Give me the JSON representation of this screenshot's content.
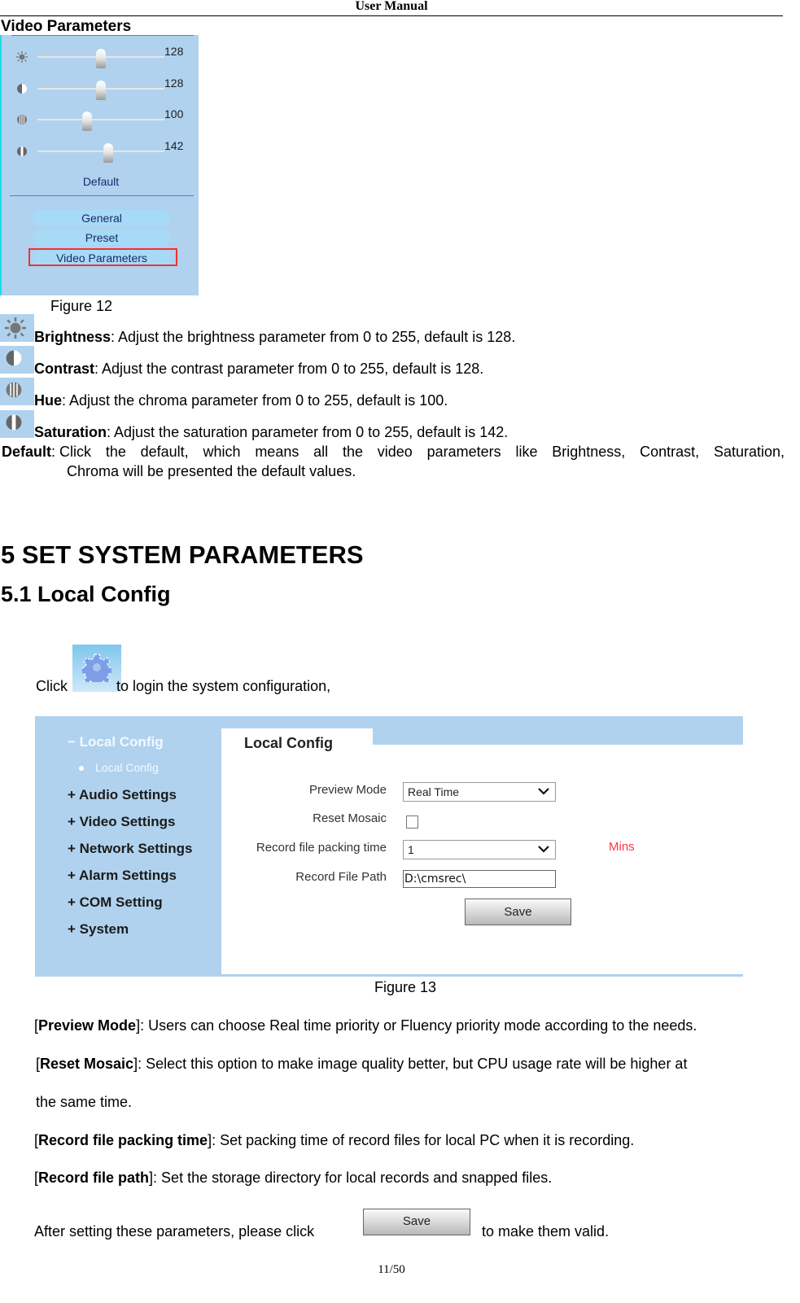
{
  "header": {
    "title": "User Manual"
  },
  "video_parameters": {
    "heading": "Video Parameters",
    "figure": {
      "sliders": [
        {
          "name": "brightness",
          "icon": "brightness-icon",
          "value": "128",
          "fraction": 0.5
        },
        {
          "name": "contrast",
          "icon": "contrast-icon",
          "value": "128",
          "fraction": 0.5
        },
        {
          "name": "hue",
          "icon": "hue-icon",
          "value": "100",
          "fraction": 0.39
        },
        {
          "name": "saturation",
          "icon": "saturation-icon",
          "value": "142",
          "fraction": 0.56
        }
      ],
      "default_label": "Default",
      "menu": [
        {
          "label": "General"
        },
        {
          "label": "Preset"
        },
        {
          "label": "Video Parameters",
          "highlighted": true
        }
      ],
      "caption": "Figure 12"
    },
    "params": [
      {
        "term": "Brightness",
        "text": ": Adjust the brightness parameter from 0 to 255, default is 128."
      },
      {
        "term": "Contrast",
        "text": ": Adjust the contrast parameter from 0 to 255, default is 128."
      },
      {
        "term": "Hue",
        "text": ": Adjust the chroma parameter from 0 to 255, default is 100."
      },
      {
        "term": "Saturation",
        "text": ": Adjust the saturation parameter from 0 to 255, default is 142."
      }
    ],
    "default_desc": {
      "term": "Default",
      "line1_words": [
        ": Click",
        "the",
        "default,",
        "which",
        "means",
        "all",
        "the",
        "video",
        "parameters",
        "like",
        "Brightness,",
        "Contrast,",
        "Saturation,"
      ],
      "line2": "Chroma will be presented the default values."
    }
  },
  "section": {
    "h1": "5 SET SYSTEM PARAMETERS",
    "h2": "5.1 Local Config",
    "click_before": "Click",
    "click_after": "to login the system configuration,"
  },
  "figure13": {
    "sidebar": {
      "active_group": "− Local Config",
      "active_sub": "Local Config",
      "groups": [
        "+ Audio Settings",
        "+ Video Settings",
        "+ Network Settings",
        "+ Alarm Settings",
        "+ COM Setting",
        "+ System"
      ]
    },
    "tab": "Local Config",
    "form": {
      "preview_mode_label": "Preview Mode",
      "preview_mode_value": "Real Time",
      "reset_mosaic_label": "Reset Mosaic",
      "reset_mosaic_checked": false,
      "packing_time_label": "Record file packing time",
      "packing_time_value": "1",
      "packing_time_unit": "Mins",
      "file_path_label": "Record File Path",
      "file_path_value": "D:\\cmsrec\\",
      "save_label": "Save"
    },
    "caption": "Figure 13"
  },
  "descriptions": [
    {
      "term": "Preview Mode",
      "text": "]: Users can choose Real time priority or Fluency priority mode according to the needs."
    },
    {
      "term": "Reset Mosaic",
      "text": "]: Select this option to make image quality better, but CPU usage rate will be higher at"
    },
    {
      "continuation": "the same time."
    },
    {
      "term": "Record file packing time",
      "text": "]: Set packing time of record files for local PC when it is recording."
    },
    {
      "term": "Record file path",
      "text": "]: Set the storage directory for local records and snapped files."
    }
  ],
  "after": {
    "before": "After setting these parameters, please click",
    "button": "Save",
    "after": "to make them valid."
  },
  "footer": {
    "page": "11/50"
  }
}
